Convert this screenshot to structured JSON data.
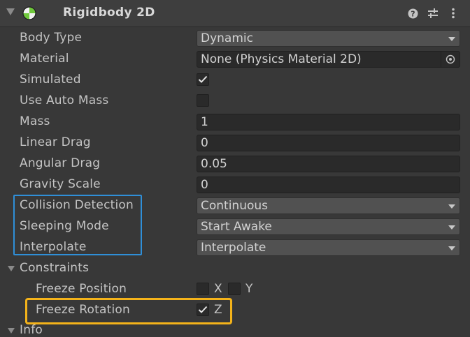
{
  "component": {
    "title": "Rigidbody 2D",
    "help_icon": "help-icon",
    "preset_icon": "preset-icon",
    "menu_icon": "kebab-menu-icon"
  },
  "properties": {
    "body_type": {
      "label": "Body Type",
      "value": "Dynamic"
    },
    "material": {
      "label": "Material",
      "value": "None (Physics Material 2D)"
    },
    "simulated": {
      "label": "Simulated",
      "checked": true
    },
    "use_auto_mass": {
      "label": "Use Auto Mass",
      "checked": false
    },
    "mass": {
      "label": "Mass",
      "value": "1"
    },
    "linear_drag": {
      "label": "Linear Drag",
      "value": "0"
    },
    "angular_drag": {
      "label": "Angular Drag",
      "value": "0.05"
    },
    "gravity_scale": {
      "label": "Gravity Scale",
      "value": "0"
    },
    "collision_detection": {
      "label": "Collision Detection",
      "value": "Continuous"
    },
    "sleeping_mode": {
      "label": "Sleeping Mode",
      "value": "Start Awake"
    },
    "interpolate": {
      "label": "Interpolate",
      "value": "Interpolate"
    }
  },
  "constraints": {
    "label": "Constraints",
    "freeze_position": {
      "label": "Freeze Position",
      "x_label": "X",
      "y_label": "Y",
      "x_checked": false,
      "y_checked": false
    },
    "freeze_rotation": {
      "label": "Freeze Rotation",
      "z_label": "Z",
      "z_checked": true
    }
  },
  "info": {
    "label": "Info"
  },
  "colors": {
    "highlight_blue": "#2f8fd8",
    "highlight_yellow": "#f4b31a",
    "component_icon_green": "#6fc93b"
  }
}
